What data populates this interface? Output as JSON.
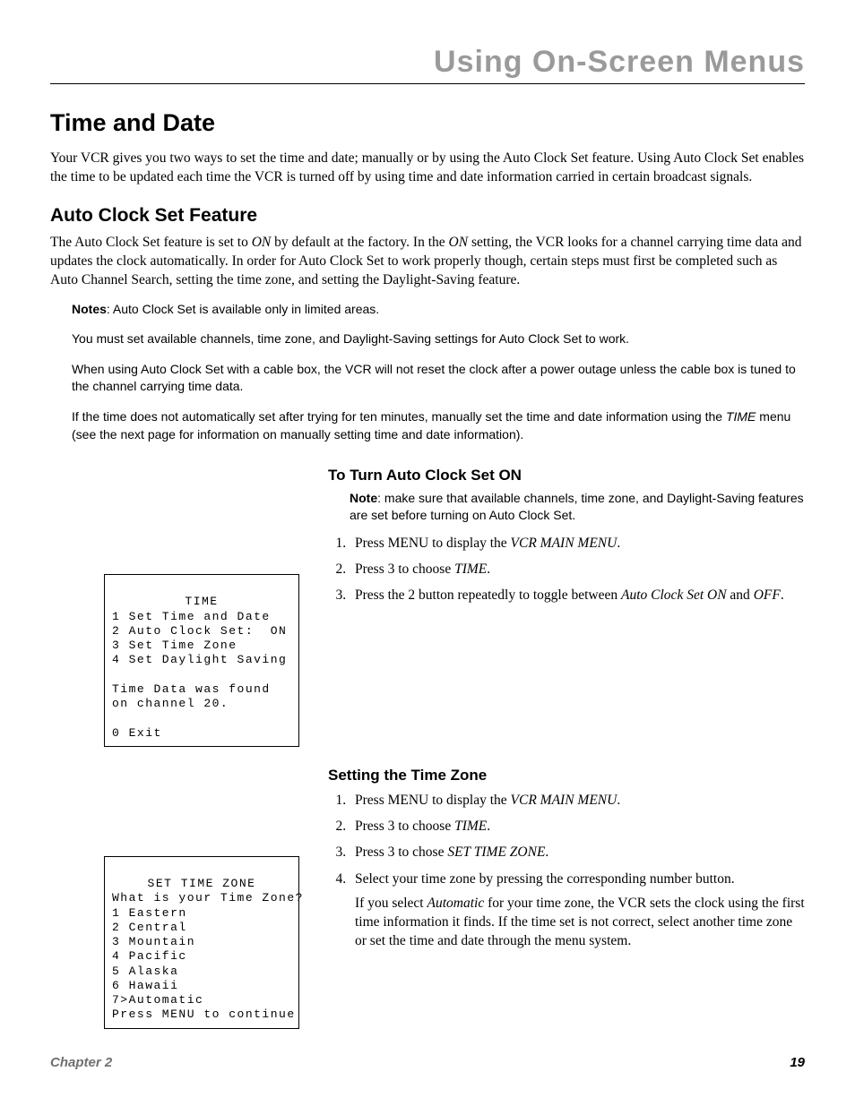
{
  "header": {
    "running_title": "Using On-Screen Menus"
  },
  "section": {
    "title": "Time and Date",
    "intro": "Your VCR gives you two ways to set the time and date; manually or by using the Auto Clock Set feature. Using Auto Clock Set enables the time to be updated each time the VCR is turned off by using time and date information carried in certain broadcast signals."
  },
  "auto_clock": {
    "heading": "Auto Clock Set Feature",
    "p1a": "The Auto Clock Set feature is set to ",
    "p1_on1": "ON",
    "p1b": " by default at the factory. In the ",
    "p1_on2": "ON",
    "p1c": " setting, the VCR looks for a channel carrying time data and updates the clock automatically. In order for Auto Clock Set to work properly though, certain steps must first be completed such as Auto Channel Search, setting the time zone, and setting the Daylight-Saving feature.",
    "notes_label": "Notes",
    "n1": ": Auto Clock Set is available only in limited areas.",
    "n2": "You must set available channels, time zone, and Daylight-Saving settings for Auto Clock Set to work.",
    "n3": "When using Auto Clock Set with a cable box, the VCR will not reset the clock after a power outage unless the cable box is tuned to the channel carrying time data.",
    "n4a": "If the time does not automatically set after trying for ten minutes, manually set the time and date information using the ",
    "n4_time": "TIME",
    "n4b": " menu (see the next page for information on manually setting time and date information)."
  },
  "turn_on": {
    "heading": "To Turn Auto Clock Set ON",
    "note_label": "Note",
    "note_body": ": make sure that available channels, time zone, and Daylight-Saving features are set before turning on Auto Clock Set.",
    "s1a": "Press MENU to display the ",
    "s1_main": "VCR MAIN MENU",
    "s1b": ".",
    "s2a": "Press 3 to choose ",
    "s2_time": "TIME",
    "s2b": ".",
    "s3a": "Press the 2 button repeatedly to toggle between ",
    "s3_acson": "Auto Clock Set ON",
    "s3b": " and ",
    "s3_off": "OFF",
    "s3c": "."
  },
  "osd_time": {
    "title": "TIME",
    "l1": "1 Set Time and Date",
    "l2": "2 Auto Clock Set:  ON",
    "l3": "3 Set Time Zone",
    "l4": "4 Set Daylight Saving",
    "blank": "",
    "l5": "Time Data was found",
    "l6": "on channel 20.",
    "l7": "0 Exit"
  },
  "time_zone": {
    "heading": "Setting the Time Zone",
    "s1a": "Press MENU to display the ",
    "s1_main": "VCR MAIN MENU",
    "s1b": ".",
    "s2a": "Press 3 to choose ",
    "s2_time": "TIME",
    "s2b": ".",
    "s3a": "Press 3 to chose ",
    "s3_stz": "SET TIME ZONE",
    "s3b": ".",
    "s4": "Select your time zone by pressing the corresponding number button.",
    "s4_p_a": "If you select ",
    "s4_auto": "Automatic",
    "s4_p_b": " for your time zone, the VCR sets the clock using the first time information it finds. If the time set is not correct, select another time zone or set the time and date through the menu system."
  },
  "osd_zone": {
    "title": "SET TIME ZONE",
    "q": "What is your Time Zone?",
    "l1": "1 Eastern",
    "l2": "2 Central",
    "l3": "3 Mountain",
    "l4": "4 Pacific",
    "l5": "5 Alaska",
    "l6": "6 Hawaii",
    "l7": "7>Automatic",
    "l8": "Press MENU to continue"
  },
  "footer": {
    "chapter": "Chapter 2",
    "page": "19"
  }
}
